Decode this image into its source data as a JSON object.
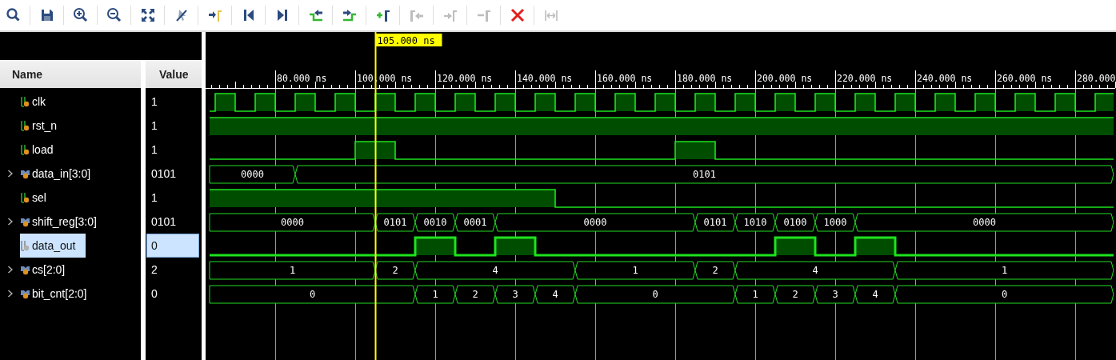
{
  "toolbar": [
    {
      "kind": "search",
      "disabled": false
    },
    {
      "kind": "save",
      "disabled": false
    },
    {
      "kind": "zoom-in",
      "disabled": false
    },
    {
      "kind": "zoom-out",
      "disabled": false
    },
    {
      "kind": "zoom-fit",
      "disabled": false
    },
    {
      "kind": "cursor-off",
      "disabled": false
    },
    {
      "kind": "go-to-cursor",
      "disabled": false
    },
    {
      "kind": "go-to-start",
      "disabled": false
    },
    {
      "kind": "go-to-end",
      "disabled": false
    },
    {
      "kind": "previous-transition",
      "disabled": false
    },
    {
      "kind": "next-transition",
      "disabled": false
    },
    {
      "kind": "add-marker",
      "disabled": false
    },
    {
      "kind": "previous-marker",
      "disabled": true
    },
    {
      "kind": "next-marker",
      "disabled": true
    },
    {
      "kind": "remove-marker",
      "disabled": true
    },
    {
      "kind": "delete-all-markers",
      "disabled": false
    },
    {
      "kind": "distance",
      "disabled": true
    }
  ],
  "columns": {
    "name": "Name",
    "value": "Value"
  },
  "signals": [
    {
      "name": "clk",
      "value": "1",
      "kind": "bit",
      "selected": false
    },
    {
      "name": "rst_n",
      "value": "1",
      "kind": "bit",
      "selected": false
    },
    {
      "name": "load",
      "value": "1",
      "kind": "bit",
      "selected": false
    },
    {
      "name": "data_in[3:0]",
      "value": "0101",
      "kind": "bus",
      "selected": false,
      "expanded": false,
      "wave_labels": [
        "0000",
        "0101"
      ]
    },
    {
      "name": "sel",
      "value": "1",
      "kind": "bit",
      "selected": false
    },
    {
      "name": "shift_reg[3:0]",
      "value": "0101",
      "kind": "bus",
      "selected": false,
      "expanded": false,
      "wave_labels": [
        "0000",
        "0101",
        "0010",
        "0001",
        "0000",
        "0101",
        "1010",
        "0100",
        "1000",
        "0000"
      ]
    },
    {
      "name": "data_out",
      "value": "0",
      "kind": "bit",
      "selected": true
    },
    {
      "name": "cs[2:0]",
      "value": "2",
      "kind": "bus",
      "selected": false,
      "expanded": false,
      "wave_labels": [
        "1",
        "2",
        "4",
        "1",
        "2",
        "4",
        "1"
      ]
    },
    {
      "name": "bit_cnt[2:0]",
      "value": "0",
      "kind": "bus",
      "selected": false,
      "expanded": false,
      "wave_labels": [
        "0",
        "1",
        "2",
        "3",
        "4",
        "0",
        "1",
        "2",
        "3",
        "4",
        "0"
      ]
    }
  ],
  "timeline": {
    "ticks": [
      "80.000 ns",
      "100.000 ns",
      "120.000 ns",
      "140.000 ns",
      "160.000 ns",
      "180.000 ns",
      "200.000 ns",
      "220.000 ns",
      "240.000 ns",
      "260.000 ns",
      "280.000"
    ],
    "cursor_label": "105.000 ns"
  }
}
